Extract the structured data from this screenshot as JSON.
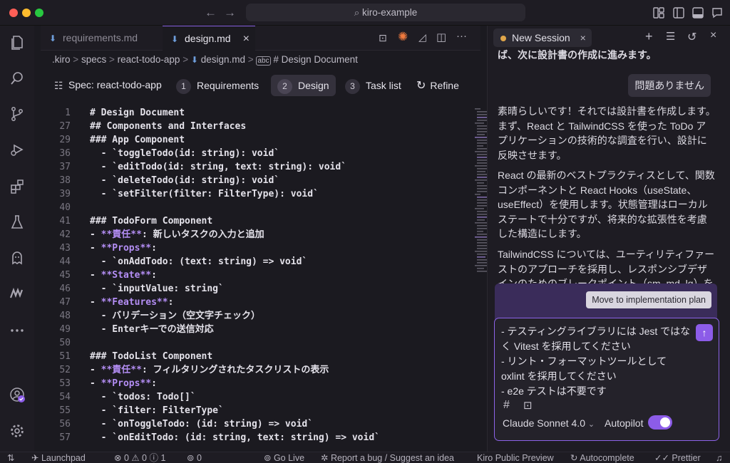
{
  "window": {
    "search": "kiro-example"
  },
  "colors": {
    "accent": "#8c5ce8",
    "traffic_red": "#fe5f57",
    "traffic_yellow": "#febc2e",
    "traffic_green": "#28c840"
  },
  "tabs": [
    {
      "label": "requirements.md",
      "active": false
    },
    {
      "label": "design.md",
      "active": true,
      "close": "×"
    }
  ],
  "breadcrumb": [
    ".kiro",
    ">",
    "specs",
    ">",
    "react-todo-app",
    ">",
    "design.md",
    ">",
    "# Design Document"
  ],
  "spec": {
    "label": "Spec: react-todo-app",
    "steps": [
      {
        "num": "1",
        "label": "Requirements"
      },
      {
        "num": "2",
        "label": "Design"
      },
      {
        "num": "3",
        "label": "Task list"
      }
    ],
    "refine": "Refine"
  },
  "code_lines": [
    {
      "n": "1",
      "text": "# Design Document"
    },
    {
      "n": "27",
      "text": "## Components and Interfaces"
    },
    {
      "n": "29",
      "text": "### App Component"
    },
    {
      "n": "36",
      "text": "  - `toggleTodo(id: string): void`"
    },
    {
      "n": "37",
      "text": "  - `editTodo(id: string, text: string): void`"
    },
    {
      "n": "38",
      "text": "  - `deleteTodo(id: string): void`"
    },
    {
      "n": "39",
      "text": "  - `setFilter(filter: FilterType): void`"
    },
    {
      "n": "40",
      "text": ""
    },
    {
      "n": "41",
      "text": "### TodoForm Component"
    },
    {
      "n": "42",
      "pre": "- ",
      "kw": "**責任**",
      "post": ": 新しいタスクの入力と追加"
    },
    {
      "n": "43",
      "pre": "- ",
      "kw": "**Props**",
      "post": ":"
    },
    {
      "n": "44",
      "text": "  - `onAddTodo: (text: string) => void`"
    },
    {
      "n": "45",
      "pre": "- ",
      "kw": "**State**",
      "post": ":"
    },
    {
      "n": "46",
      "text": "  - `inputValue: string`"
    },
    {
      "n": "47",
      "pre": "- ",
      "kw": "**Features**",
      "post": ":"
    },
    {
      "n": "48",
      "text": "  - バリデーション（空文字チェック）"
    },
    {
      "n": "49",
      "text": "  - Enterキーでの送信対応"
    },
    {
      "n": "50",
      "text": ""
    },
    {
      "n": "51",
      "text": "### TodoList Component"
    },
    {
      "n": "52",
      "pre": "- ",
      "kw": "**責任**",
      "post": ": フィルタリングされたタスクリストの表示"
    },
    {
      "n": "53",
      "pre": "- ",
      "kw": "**Props**",
      "post": ":"
    },
    {
      "n": "54",
      "text": "  - `todos: Todo[]`"
    },
    {
      "n": "55",
      "text": "  - `filter: FilterType`"
    },
    {
      "n": "56",
      "text": "  - `onToggleTodo: (id: string) => void`"
    },
    {
      "n": "57",
      "text": "  - `onEditTodo: (id: string, text: string) => void`"
    }
  ],
  "chat": {
    "session_label": "New Session",
    "top_text": "ば、次に設計書の作成に進みます。",
    "user_message": "問題ありません",
    "para1": "素晴らしいです！それでは設計書を作成します。まず、React と TailwindCSS を使った ToDo アプリケーションの技術的な調査を行い、設計に反映させます。",
    "para2": "React の最新のベストプラクティスとして、関数コンポーネントと React Hooks（useState、useEffect）を使用します。状態管理はローカルステートで十分ですが、将来的な拡張性を考慮した構造にします。",
    "para3": "TailwindCSS については、ユーティリティファーストのアプローチを採用し、レスポンシブデザインのためのブレークポイント（sm, md, lg）を",
    "move_button": "Move to implementation plan",
    "input_lines": [
      "- テスティングライブラリには Jest ではな",
      "く Vitest を採用してください",
      "- リント・フォーマットツールとして",
      "oxlint を採用してください",
      "- e2e テストは不要です"
    ],
    "model": "Claude Sonnet 4.0",
    "autopilot_label": "Autopilot",
    "autopilot_on": true
  },
  "status": {
    "launchpad": "Launchpad",
    "problems": "⊗ 0 ⚠ 0 ⓘ 1",
    "ports": "0",
    "go_live": "Go Live",
    "report": "Report a bug / Suggest an idea",
    "preview": "Kiro Public Preview",
    "autocomplete": "Autocomplete",
    "prettier": "Prettier"
  }
}
